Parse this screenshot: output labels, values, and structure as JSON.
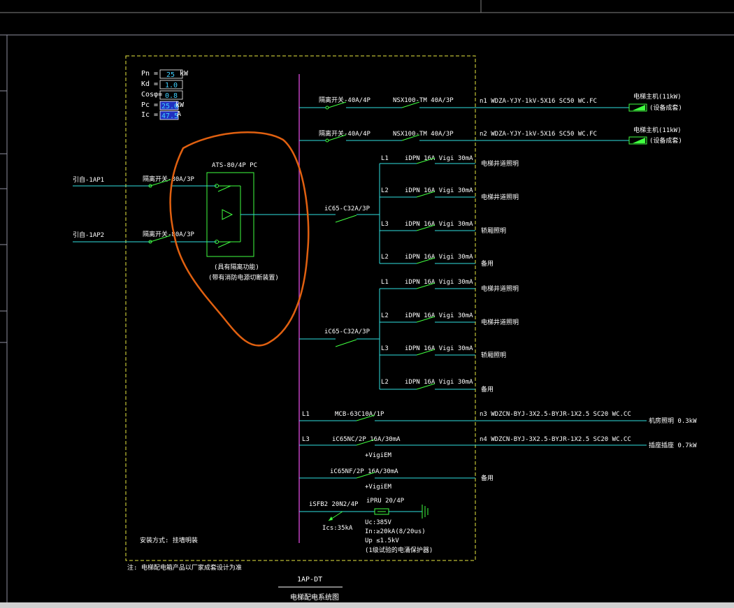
{
  "params": {
    "pn_label": "Pn =",
    "pn_value": "25",
    "pn_unit": "kW",
    "kd_label": "Kd =",
    "kd_value": "1.0",
    "cos_label": "Cosφ=",
    "cos_value": "0.8",
    "pc_label": "Pc =",
    "pc_value": "25.0",
    "pc_unit": "kW",
    "ic_label": "Ic =",
    "ic_value": "47.5",
    "ic_unit": "A"
  },
  "inputs": {
    "in1_label": "引自-1AP1",
    "in1_breaker": "隔离开关-80A/3P",
    "in2_label": "引自-1AP2",
    "in2_breaker": "隔离开关-80A/3P",
    "ats_label": "ATS-80/4P PC",
    "ats_note1": "(具有隔离功能)",
    "ats_note2": "(带有消防电源切断装置)"
  },
  "outgoing": {
    "o1_iso": "隔离开关-40A/4P",
    "o1_breaker": "NSX100-TM 40A/3P",
    "o1_circuit": "n1 WDZA-YJY-1kV-5X16 SC50 WC.FC",
    "o1_load1": "电梯主机(11kW)",
    "o1_load2": "(设备成套)",
    "o2_iso": "隔离开关-40A/4P",
    "o2_breaker": "NSX100-TM 40A/3P",
    "o2_circuit": "n2 WDZA-YJY-1kV-5X16 SC50 WC.FC",
    "o2_load1": "电梯主机(11kW)",
    "o2_load2": "(设备成套)",
    "g1_breaker": "iC65-C32A/3P",
    "g2_breaker": "iC65-C32A/3P",
    "sub_breaker": "iDPN 16A Vigi 30mA",
    "g1_phases": [
      "L1",
      "L2",
      "L3",
      "L2"
    ],
    "g1_loads": [
      "电梯井道照明",
      "电梯井道照明",
      "轿厢照明",
      "备用"
    ],
    "g2_phases": [
      "L1",
      "L2",
      "L3",
      "L2"
    ],
    "g2_loads": [
      "电梯井道照明",
      "电梯井道照明",
      "轿厢照明",
      "备用"
    ],
    "b1_phase": "L1",
    "b1_breaker": "MCB-63C10A/1P",
    "b1_circuit": "n3 WDZCN-BYJ-3X2.5-BYJR-1X2.5 SC20 WC.CC",
    "b1_load": "机房照明 0.3kW",
    "b2_phase": "L3",
    "b2_breaker": "iC65NC/2P 16A/30mA",
    "b2_vigi": "+VigiEM",
    "b2_circuit": "n4 WDZCN-BYJ-3X2.5-BYJR-1X2.5 SC20 WC.CC",
    "b2_load": "插座插座 0.7kW",
    "b3_breaker": "iC65NF/2P 16A/30mA",
    "b3_vigi": "+VigiEM",
    "b3_load": "备用",
    "spd_breaker": "iSFB2 20N2/4P",
    "spd_ics": "Ics:35kA",
    "spd_label": "iPRU 20/4P",
    "spd_uc": "Uc:385V",
    "spd_in": "In:≥20kA(8/20us)",
    "spd_up": "Up ≤1.5kV",
    "spd_note": "(1级试验的电涌保护器)"
  },
  "box": {
    "note_bottom": "安装方式: 挂墙明装",
    "note_footer": "注: 电梯配电箱产品以厂家成套设计为准"
  },
  "titleblock": {
    "code": "1AP-DT",
    "name": "电梯配电系统图"
  },
  "colors": {
    "bus": "#c040c0",
    "wire": "#30e0e0",
    "device": "#40ff40",
    "frame": "#e8e840",
    "markup": "#e06010"
  }
}
